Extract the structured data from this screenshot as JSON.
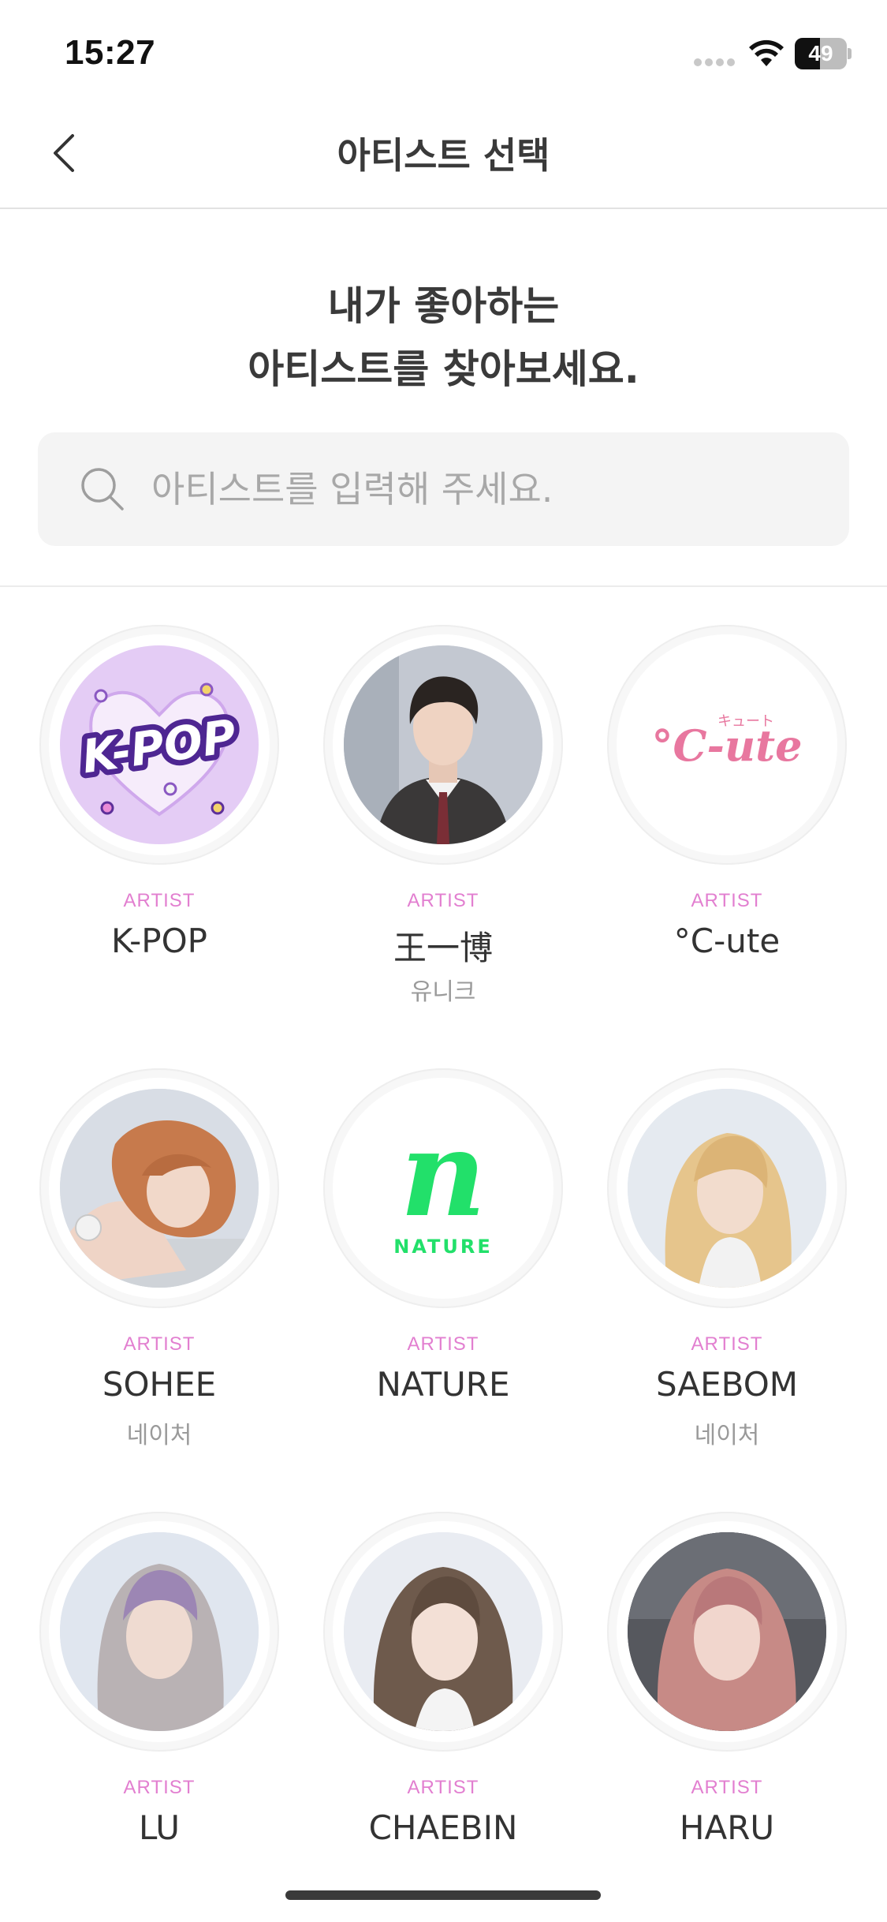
{
  "status_bar": {
    "time": "15:27",
    "battery_text": "49",
    "battery_level": 0.49
  },
  "nav": {
    "title": "아티스트 선택",
    "back_icon": "chevron-left-icon"
  },
  "headline": {
    "line1": "내가 좋아하는",
    "line2": "아티스트를 찾아보세요."
  },
  "search": {
    "placeholder": "아티스트를 입력해 주세요.",
    "value": "",
    "icon": "search-icon"
  },
  "colors": {
    "accent_pink": "#e27fd0",
    "text_dark": "#333333",
    "text_muted": "#9a9a9a",
    "search_bg": "#f4f4f4"
  },
  "artists": [
    {
      "tag": "ARTIST",
      "name": "K-POP",
      "group": ""
    },
    {
      "tag": "ARTIST",
      "name": "王一博",
      "group": "유니크"
    },
    {
      "tag": "ARTIST",
      "name": "°C-ute",
      "group": ""
    },
    {
      "tag": "ARTIST",
      "name": "SOHEE",
      "group": "네이처"
    },
    {
      "tag": "ARTIST",
      "name": "NATURE",
      "group": ""
    },
    {
      "tag": "ARTIST",
      "name": "SAEBOM",
      "group": "네이처"
    },
    {
      "tag": "ARTIST",
      "name": "LU",
      "group": ""
    },
    {
      "tag": "ARTIST",
      "name": "CHAEBIN",
      "group": ""
    },
    {
      "tag": "ARTIST",
      "name": "HARU",
      "group": ""
    }
  ],
  "logos": {
    "kpop": "K-POP",
    "cute_small": "キュート",
    "cute": "°C-ute",
    "nature_mark": "n",
    "nature_word": "NATURE"
  }
}
